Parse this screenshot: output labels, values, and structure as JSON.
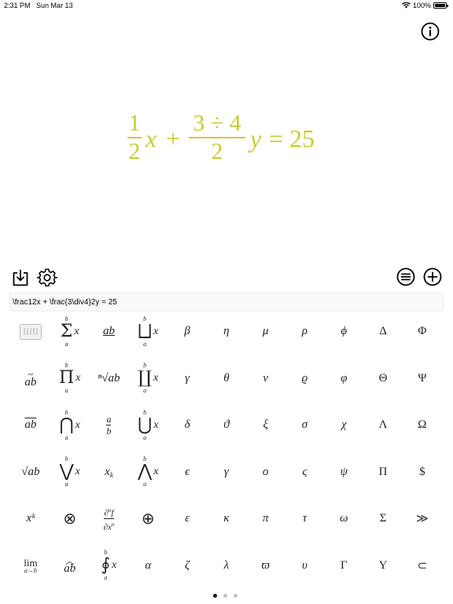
{
  "status_bar": {
    "time": "2:31 PM",
    "date": "Sun Mar 13",
    "battery_text": "100%",
    "battery_level": 1.0
  },
  "equation": {
    "color": "#c7cc35",
    "frac1_num": "1",
    "frac1_den": "2",
    "x_var": "x",
    "plus": "+",
    "frac2_num": "3 ÷ 4",
    "frac2_den": "2",
    "y_var": "y",
    "equals_rhs": "= 25"
  },
  "toolbar": {
    "save_icon": "save-download-icon",
    "gear_icon": "gear-icon",
    "list_icon": "list-circle-icon",
    "add_icon": "plus-circle-icon"
  },
  "input": {
    "value": "\\frac12x + \\frac{3\\div4}2y = 25"
  },
  "symbols": {
    "row1": [
      "keyboard",
      "Σ",
      "ab",
      "⨆",
      "β",
      "η",
      "μ",
      "ρ",
      "ϕ",
      "Δ",
      "Φ"
    ],
    "row2": [
      "ab",
      "Π",
      "ⁿ√ab",
      "∐",
      "γ",
      "θ",
      "ν",
      "ϱ",
      "φ",
      "Θ",
      "Ψ"
    ],
    "row3": [
      "ab",
      "⋂",
      "a/b",
      "⋃",
      "δ",
      "ϑ",
      "ξ",
      "σ",
      "χ",
      "Λ",
      "Ω"
    ],
    "row4": [
      "√ab",
      "⋁",
      "xk",
      "⋀",
      "ϵ",
      "γ",
      "o",
      "ς",
      "ψ",
      "Π",
      "$"
    ],
    "row5": [
      "xᵏ",
      "⊗",
      "∂ⁿf/∂xⁿ",
      "⊕",
      "ε",
      "κ",
      "π",
      "τ",
      "ω",
      "Σ",
      "≫"
    ],
    "row6": [
      "lim",
      "ab",
      "∮",
      "α",
      "ζ",
      "λ",
      "ϖ",
      "υ",
      "Γ",
      "Υ",
      "⊂"
    ]
  },
  "labels": {
    "a": "a",
    "b": "b",
    "x": "x",
    "k": "k",
    "n": "n",
    "f": "f",
    "lim_sub": "a→b",
    "lim": "lim"
  },
  "pager": {
    "pages": 3,
    "current": 1
  }
}
